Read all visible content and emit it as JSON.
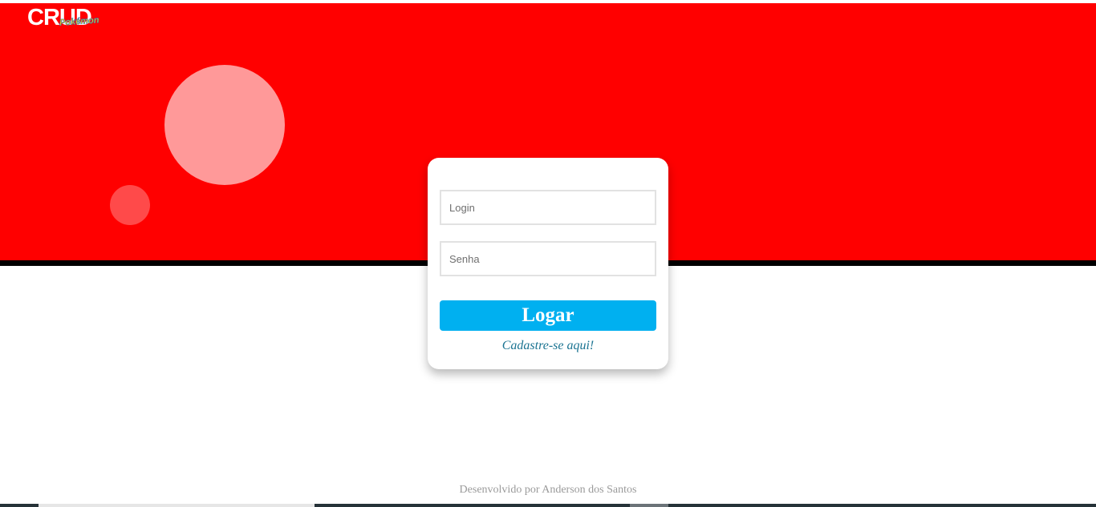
{
  "logo": {
    "main_text": "CRUD",
    "sub_text": "Pokémon"
  },
  "login_form": {
    "login_placeholder": "Login",
    "password_placeholder": "Senha",
    "submit_label": "Logar",
    "register_link": "Cadastre-se aqui!"
  },
  "footer": {
    "credit": "Desenvolvido por Anderson dos Santos"
  },
  "colors": {
    "hero_red": "#ff0000",
    "button_blue": "#00b0f0",
    "link_teal": "#1a7391"
  }
}
